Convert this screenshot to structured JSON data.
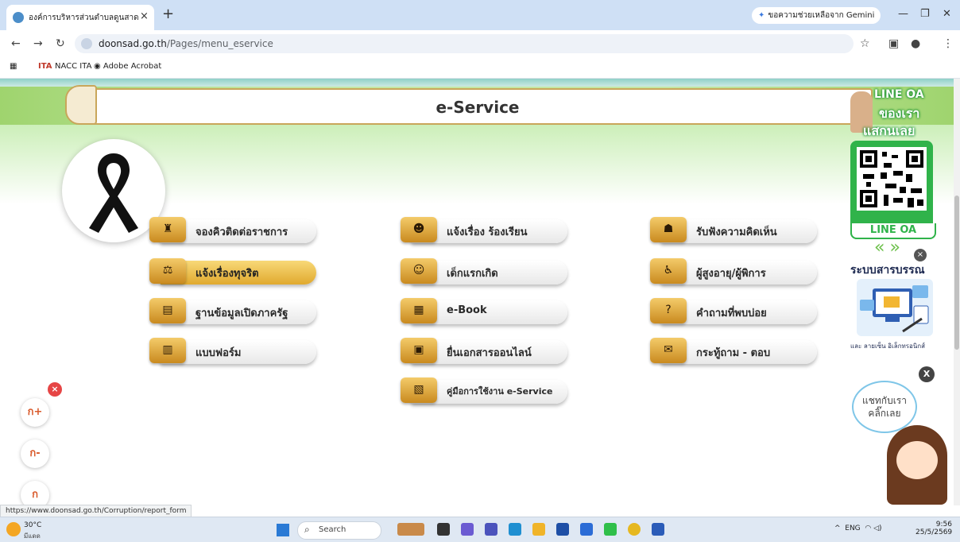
{
  "browser": {
    "tab_title": "องค์การบริหารส่วนตำบลดูนสาด",
    "tab_close": "×",
    "new_tab": "+",
    "gemini_label": "ขอความช่วยเหลือจาก Gemini",
    "url_host": "doonsad.go.th",
    "url_path": "/Pages/menu_eservice",
    "bookmarks": [
      "NACC ITA",
      "Adobe Acrobat"
    ],
    "status_url": "https://www.doonsad.go.th/Corruption/report_form"
  },
  "page": {
    "title": "e-Service",
    "services": [
      {
        "label": "จองคิวติดต่อราชการ",
        "icon": "queue-icon",
        "glyph": "♜"
      },
      {
        "label": "แจ้งเรื่อง ร้องเรียน",
        "icon": "complaint-icon",
        "glyph": "☻"
      },
      {
        "label": "รับฟังความคิดเห็น",
        "icon": "opinion-icon",
        "glyph": "☗"
      },
      {
        "label": "แจ้งเรื่องทุจริต",
        "icon": "corruption-icon",
        "glyph": "⚖"
      },
      {
        "label": "เด็กแรกเกิด",
        "icon": "baby-icon",
        "glyph": "☺"
      },
      {
        "label": "ผู้สูงอายุ/ผู้พิการ",
        "icon": "elderly-icon",
        "glyph": "♿"
      },
      {
        "label": "ฐานข้อมูลเปิดภาครัฐ",
        "icon": "open-data-icon",
        "glyph": "▤"
      },
      {
        "label": "e-Book",
        "icon": "ebook-icon",
        "glyph": "▦"
      },
      {
        "label": "คำถามที่พบบ่อย",
        "icon": "faq-icon",
        "glyph": "?"
      },
      {
        "label": "แบบฟอร์ม",
        "icon": "form-icon",
        "glyph": "▥"
      },
      {
        "label": "ยื่นเอกสารออนไลน์",
        "icon": "submit-doc-icon",
        "glyph": "▣"
      },
      {
        "label": "กระทู้ถาม - ตอบ",
        "icon": "forum-icon",
        "glyph": "✉"
      },
      {
        "label": "คู่มือการใช้งาน e-Service",
        "icon": "manual-icon",
        "glyph": "▧"
      }
    ],
    "font_buttons": [
      "ก+",
      "ก-",
      "ก"
    ],
    "font_close": "×",
    "line_oa": {
      "line1": "LINE OA",
      "line2": "ของเรา",
      "line3": "แสกนเลย",
      "label": "LINE OA"
    },
    "arrows": "«»",
    "close_x": "×",
    "sarabun_title": "ระบบสารบรรณ",
    "sarabun_sub": "และ ลายเซ็น อิเล็กทรอนิกส์",
    "chat_close": "X",
    "chat_line1": "แชทกับเรา",
    "chat_line2": "คลิ๊กเลย"
  },
  "taskbar": {
    "temp": "30°C",
    "weather": "มีแดด",
    "search_label": "Search",
    "tray": "ENG",
    "time": "9:56",
    "date": "25/5/2569"
  },
  "colors": {
    "accent_green": "#30b34a",
    "gold": "#e0a92e"
  }
}
